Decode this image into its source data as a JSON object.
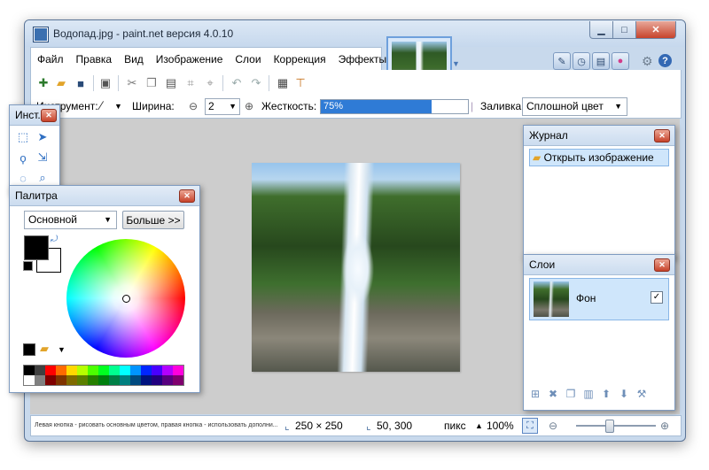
{
  "window": {
    "title": "Водопад.jpg - paint.net версия 4.0.10"
  },
  "menu": [
    "Файл",
    "Правка",
    "Вид",
    "Изображение",
    "Слои",
    "Коррекция",
    "Эффекты"
  ],
  "toolbar": {
    "tool_label": "Инструмент:",
    "width_label": "Ширина:",
    "width_value": "2",
    "hardness_label": "Жесткость:",
    "hardness_value": "75%",
    "hardness_level": 0.75,
    "fill_label": "Заливка:",
    "fill_value": "Сплошной цвет"
  },
  "tools_panel": {
    "title": "Инст..."
  },
  "palette_panel": {
    "title": "Палитра",
    "mode_select": "Основной",
    "more_button": "Больше >>",
    "primary_color": "#000000",
    "secondary_color": "#ffffff"
  },
  "history_panel": {
    "title": "Журнал",
    "items": [
      "Открыть изображение"
    ]
  },
  "layers_panel": {
    "title": "Слои",
    "layers": [
      {
        "name": "Фон",
        "visible": true
      }
    ]
  },
  "statusbar": {
    "hint": "Левая кнопка - рисовать основным цветом, правая кнопка - использовать дополни...",
    "image_size": "250 × 250",
    "cursor_position": "50, 300",
    "units": "пикс",
    "zoom": "100%"
  }
}
